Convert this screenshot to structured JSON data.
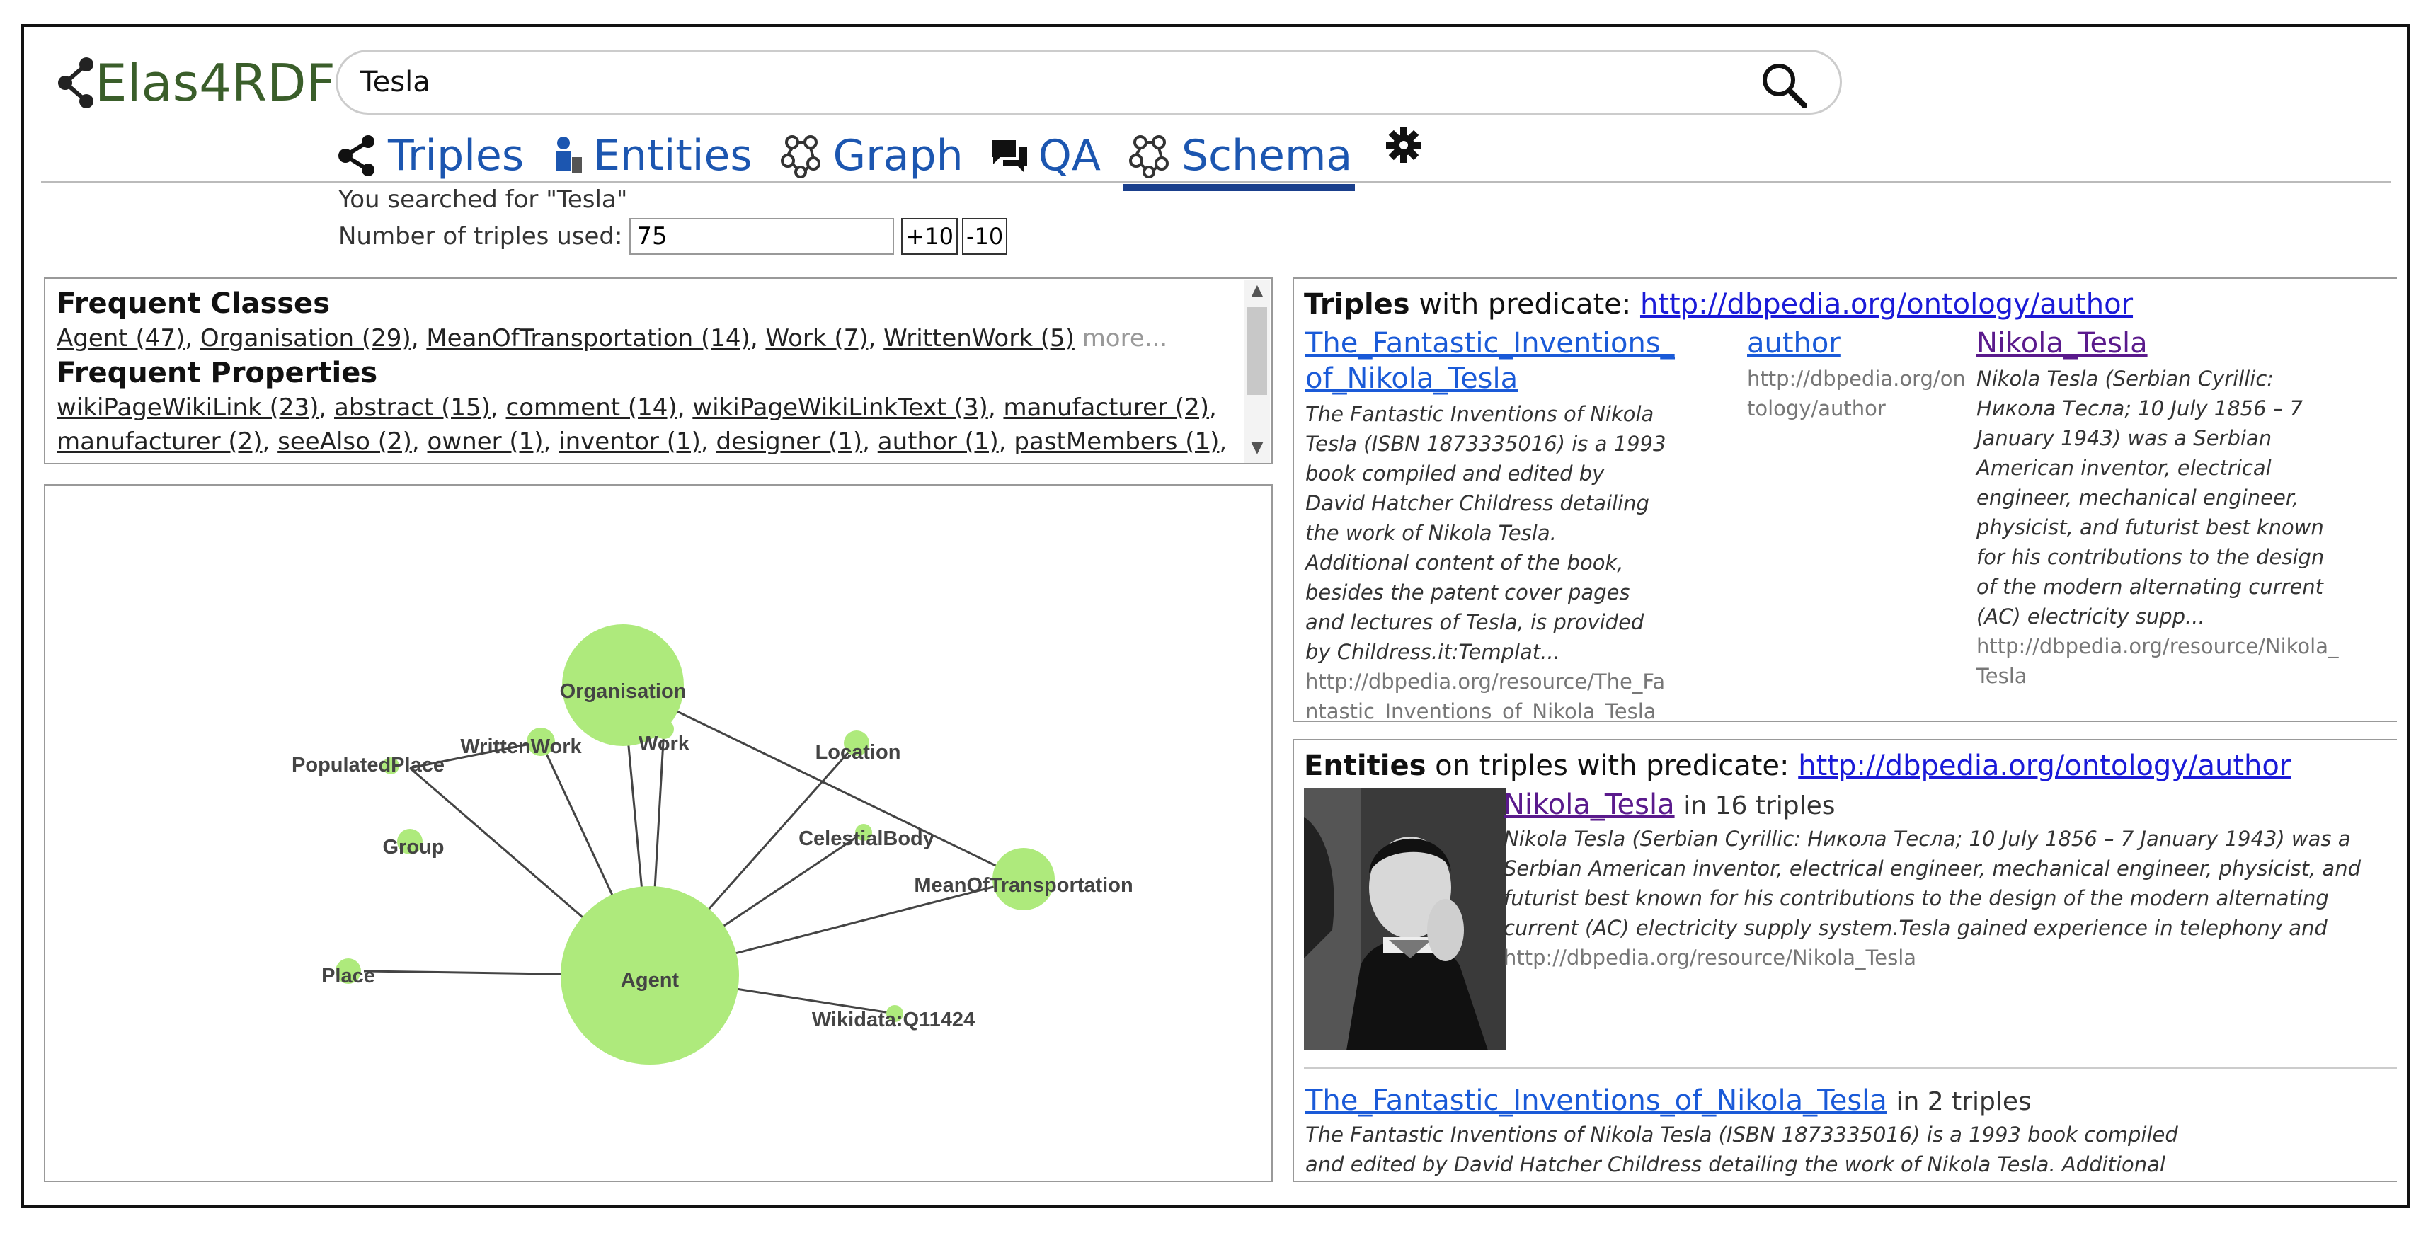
{
  "app": {
    "logo_text": "Elas4RDF"
  },
  "search": {
    "value": "Tesla",
    "button_icon": "search-icon"
  },
  "tabs": [
    {
      "label": "Triples",
      "icon": "share-icon"
    },
    {
      "label": "Entities",
      "icon": "person-icon"
    },
    {
      "label": "Graph",
      "icon": "graph-icon"
    },
    {
      "label": "QA",
      "icon": "chat-icon"
    },
    {
      "label": "Schema",
      "icon": "graph-icon",
      "active": true
    }
  ],
  "status": {
    "searched": "You searched for \"Tesla\"",
    "ntriples_label": "Number of triples used:",
    "ntriples_value": "75",
    "plus_label": "+10",
    "minus_label": "-10"
  },
  "frequent": {
    "classes_title": "Frequent Classes",
    "classes": [
      "Agent (47)",
      "Organisation (29)",
      "MeanOfTransportation (14)",
      "Work (7)",
      "WrittenWork (5)"
    ],
    "more_label": "more...",
    "properties_title": "Frequent Properties",
    "properties_line1": [
      "wikiPageWikiLink (23)",
      "abstract (15)",
      "comment (14)",
      "wikiPageWikiLinkText (3)",
      "manufacturer (2)"
    ],
    "properties_line2": [
      "manufacturer (2)",
      "seeAlso (2)",
      "owner (1)",
      "inventor (1)",
      "designer (1)",
      "author (1)",
      "pastMembers (1)"
    ]
  },
  "graph": {
    "nodes": [
      "Organisation",
      "Agent",
      "MeanOfTransportation",
      "Work",
      "WrittenWork",
      "PopulatedPlace",
      "Group",
      "Location",
      "CelestialBody",
      "Place",
      "Wikidata:Q11424"
    ],
    "node_color": "#aeea7c"
  },
  "triples_panel": {
    "title_bold": "Triples",
    "title_rest": "with predicate:",
    "predicate_link": "http://dbpedia.org/ontology/author",
    "subject": {
      "label_l1": "The_Fantastic_Inventions_",
      "label_l2": "of_Nikola_Tesla",
      "desc": "The Fantastic Inventions of Nikola Tesla (ISBN 1873335016) is a 1993 book compiled and edited by David Hatcher Childress detailing the work of Nikola Tesla. Additional content of the book, besides the patent cover pages and lectures of Tesla, is provided by Childress.it:Templat...",
      "uri": "http://dbpedia.org/resource/The_Fantastic_Inventions_of_Nikola_Tesla"
    },
    "predicate": {
      "label": "author",
      "uri": "http://dbpedia.org/ontology/author"
    },
    "object": {
      "label": "Nikola_Tesla",
      "desc": "Nikola Tesla (Serbian Cyrillic: Никола Тесла; 10 July 1856 – 7 January 1943) was a Serbian American inventor, electrical engineer, mechanical engineer, physicist, and futurist best known for his contributions to the design of the modern alternating current (AC) electricity supp...",
      "uri": "http://dbpedia.org/resource/Nikola_Tesla"
    }
  },
  "entities_panel": {
    "title_bold": "Entities",
    "title_rest": "on triples with predicate:",
    "predicate_link": "http://dbpedia.org/ontology/author",
    "items": [
      {
        "label": "Nikola_Tesla",
        "count": "in 16 triples",
        "desc": "Nikola Tesla (Serbian Cyrillic: Никола Тесла; 10 July 1856 – 7 January 1943) was a Serbian American inventor, electrical engineer, mechanical engineer, physicist, and futurist best known for his contributions to the design of the modern alternating current (AC) electricity supply system.Tesla gained experience in telephony and electrical engineering before emigrating to the United States in 1884 to work for Thomas Edison in New York City. @en",
        "uri": "http://dbpedia.org/resource/Nikola_Tesla"
      },
      {
        "label": "The_Fantastic_Inventions_of_Nikola_Tesla",
        "count": "in 2 triples",
        "desc": "The Fantastic Inventions of Nikola Tesla (ISBN 1873335016) is a 1993 book compiled and edited by David Hatcher Childress detailing the work of Nikola Tesla. Additional content of"
      }
    ]
  }
}
